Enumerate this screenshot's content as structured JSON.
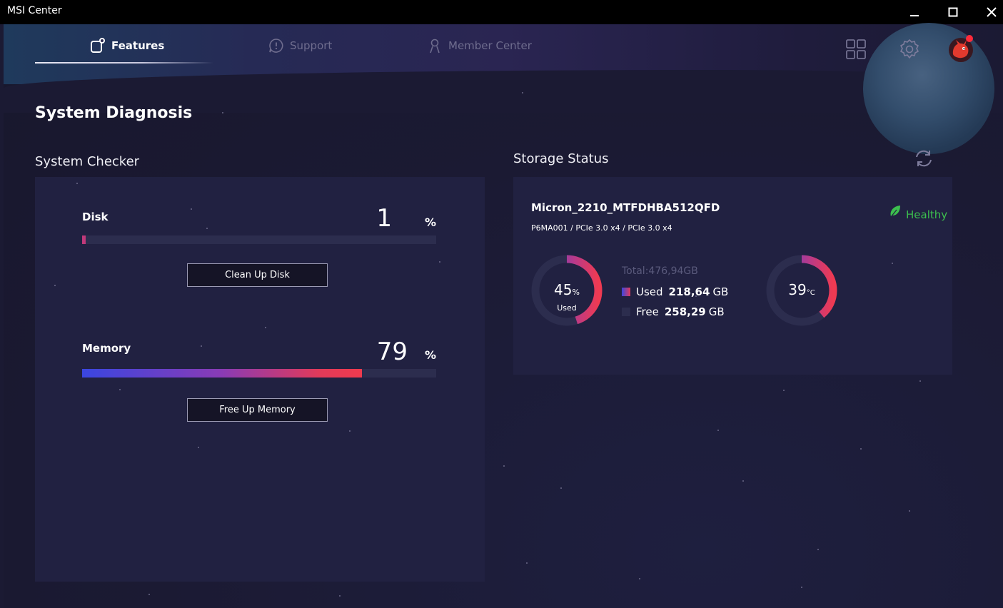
{
  "window": {
    "title": "MSI Center"
  },
  "tabs": [
    {
      "label": "Features",
      "icon": "features-icon",
      "active": true
    },
    {
      "label": "Support",
      "icon": "support-icon",
      "active": false
    },
    {
      "label": "Member Center",
      "icon": "member-icon",
      "active": false
    }
  ],
  "page": {
    "title": "System Diagnosis"
  },
  "checker": {
    "title": "System Checker",
    "disk": {
      "label": "Disk",
      "value": "1",
      "unit": "%",
      "percent": 1,
      "button": "Clean Up Disk"
    },
    "memory": {
      "label": "Memory",
      "value": "79",
      "unit": "%",
      "percent": 79,
      "button": "Free Up Memory"
    }
  },
  "storage": {
    "title": "Storage Status",
    "drive_name": "Micron_2210_MTFDHBA512QFD",
    "drive_sub": "P6MA001 / PCIe 3.0 x4 / PCIe 3.0 x4",
    "health": "Healthy",
    "used_percent": 45,
    "used_value": "45",
    "used_unit": "%",
    "used_caption": "Used",
    "total": "Total:476,94GB",
    "used_label": "Used",
    "used_amount": "218,64",
    "used_gb": "GB",
    "free_label": "Free",
    "free_amount": "258,29",
    "free_gb": "GB",
    "temp_value": "39",
    "temp_unit": "°C",
    "temp_percent": 39
  },
  "colors": {
    "accent_start": "#3a46e0",
    "accent_end": "#f03a4e",
    "healthy": "#3cbf4e",
    "panel": "#212141"
  }
}
